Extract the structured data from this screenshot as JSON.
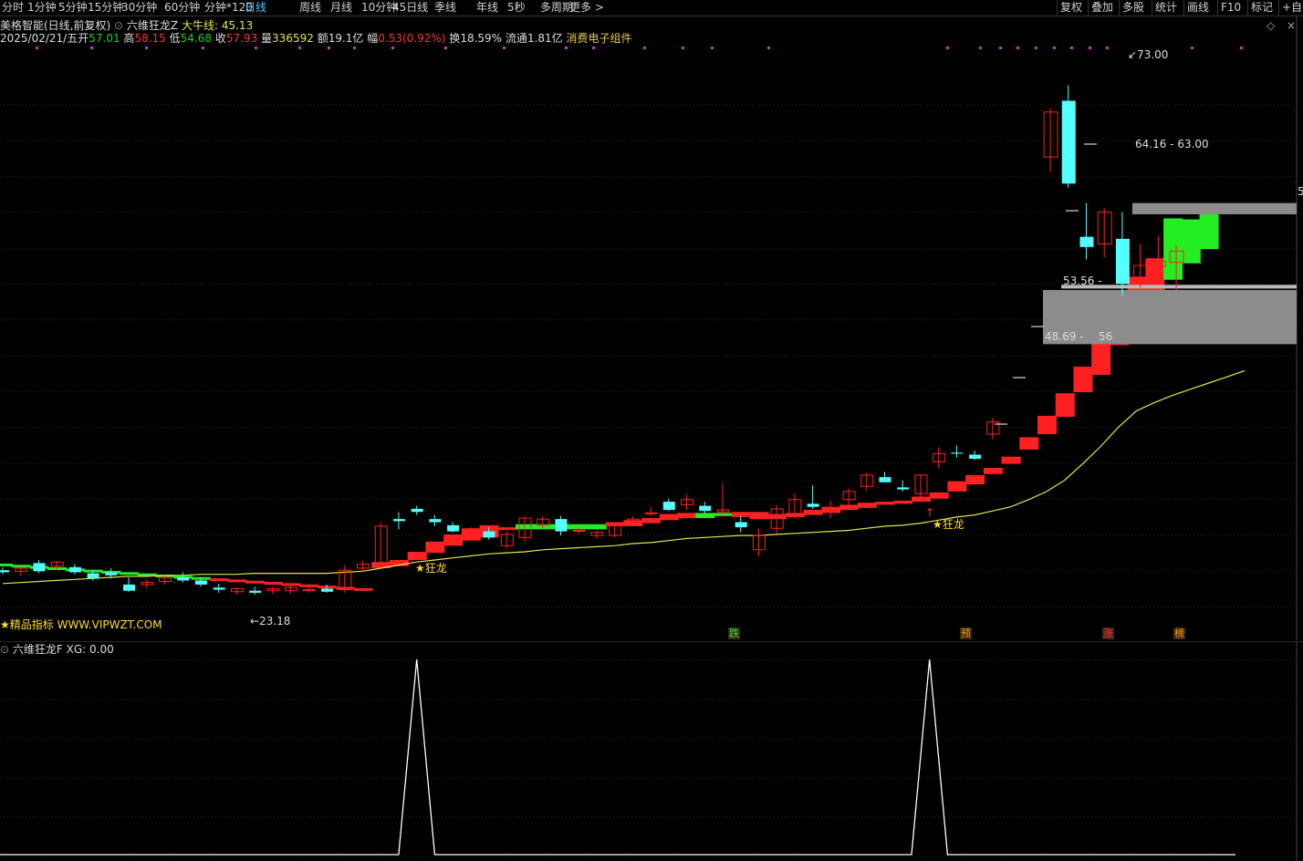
{
  "toolbar": {
    "periods": [
      "分时",
      "1分钟",
      "5分钟",
      "15分钟",
      "30分钟",
      "60分钟",
      "分钟*120",
      "日线",
      "周线",
      "月线",
      "10分钟",
      "45日线",
      "季线",
      "年线",
      "5秒",
      "多周期",
      "更多 >"
    ],
    "active_period": "日线",
    "right_buttons": [
      "复权",
      "叠加",
      "多股",
      "统计",
      "画线",
      "F10",
      "标记",
      "+自选"
    ]
  },
  "header": {
    "stock_title": "美格智能(日线,前复权)",
    "indicator_name": "六维狂龙Z",
    "ma_label": "大牛线:",
    "ma_value": "45.13",
    "diamond_icon": "◇",
    "close_icon": "×"
  },
  "quote": {
    "date": "2025/02/21/五",
    "open_label": "开",
    "open": "57.01",
    "high_label": "高",
    "high": "58.15",
    "low_label": "低",
    "low": "54.68",
    "close_label": "收",
    "close": "57.93",
    "vol_label": "量",
    "vol": "336592",
    "amount_label": "额",
    "amount": "19.1亿",
    "change_label": "幅",
    "change": "0.53(0.92%)",
    "turnover_label": "换",
    "turnover": "18.59%",
    "float_label": "流通",
    "float": "1.81亿",
    "concept": "消费电子组件"
  },
  "annotations": {
    "max_price": "73.00",
    "min_price": "23.18",
    "zone_upper": "64.16 - 63.00",
    "zone_mid": "53.56 -",
    "zone_lower": "48.69 -",
    "zone_lower_tail": "56",
    "dragon_label": "狂龙",
    "watermark": "★精品指标 WWW.VIPWZT.COM",
    "right_edge_mark": "5"
  },
  "chips": [
    {
      "text": "跌",
      "color": "#33dd33"
    },
    {
      "text": "预",
      "color": "#ff9900"
    },
    {
      "text": "涨",
      "color": "#ff3333"
    },
    {
      "text": "榜",
      "color": "#ff9900"
    }
  ],
  "sub_indicator": {
    "name": "六维狂龙F",
    "value_text": "XG: 0.00"
  },
  "colors": {
    "up": "#ff2020",
    "down": "#54ffff",
    "green_band": "#22ee22",
    "ma": "#e6e24a",
    "zone": "#8c8c8c",
    "grid": "#2a2a2a",
    "dots": "#cc33cc",
    "signal": "#ffffff"
  },
  "chart_data": [
    {
      "type": "candlestick",
      "title": "美格智能(日线,前复权)",
      "ylim": [
        20,
        76
      ],
      "series": [
        {
          "name": "K线",
          "ohlc": [
            [
              25.6,
              25.9,
              25.2,
              25.4
            ],
            [
              25.5,
              25.9,
              25.1,
              25.8
            ],
            [
              26.3,
              26.6,
              25.3,
              25.5
            ],
            [
              26.0,
              26.5,
              25.6,
              26.4
            ],
            [
              25.9,
              26.2,
              25.2,
              25.4
            ],
            [
              25.3,
              25.6,
              24.6,
              24.8
            ],
            [
              25.4,
              25.8,
              24.8,
              25.1
            ],
            [
              24.2,
              24.9,
              23.5,
              23.6
            ],
            [
              24.2,
              24.7,
              23.8,
              24.4
            ],
            [
              24.5,
              25.1,
              24.2,
              24.9
            ],
            [
              24.9,
              25.4,
              24.4,
              24.6
            ],
            [
              24.6,
              24.9,
              24.0,
              24.2
            ],
            [
              23.9,
              24.3,
              23.4,
              23.7
            ],
            [
              23.5,
              23.9,
              23.2,
              23.8
            ],
            [
              23.6,
              24.0,
              23.2,
              23.4
            ],
            [
              23.6,
              24.0,
              23.3,
              23.8
            ],
            [
              23.6,
              24.1,
              23.3,
              23.9
            ],
            [
              23.6,
              24.0,
              23.4,
              23.7
            ],
            [
              23.8,
              24.2,
              23.4,
              23.5
            ],
            [
              23.7,
              26.1,
              23.4,
              25.6
            ],
            [
              25.8,
              26.5,
              25.4,
              26.2
            ],
            [
              26.3,
              30.3,
              26.0,
              29.9
            ],
            [
              30.6,
              31.3,
              29.6,
              30.4
            ],
            [
              31.6,
              31.9,
              31.0,
              31.3
            ],
            [
              30.6,
              31.0,
              29.9,
              30.3
            ],
            [
              30.0,
              30.3,
              29.3,
              29.4
            ],
            [
              29.2,
              29.8,
              28.8,
              29.5
            ],
            [
              29.4,
              29.8,
              28.6,
              28.8
            ],
            [
              28.0,
              29.4,
              27.7,
              29.1
            ],
            [
              28.8,
              30.8,
              28.4,
              30.7
            ],
            [
              30.0,
              30.9,
              29.7,
              30.6
            ],
            [
              30.6,
              30.9,
              29.0,
              29.4
            ],
            [
              29.5,
              29.8,
              29.1,
              29.5
            ],
            [
              29.0,
              29.5,
              28.7,
              29.3
            ],
            [
              29.0,
              30.3,
              28.8,
              30.0
            ],
            [
              30.2,
              30.9,
              29.9,
              30.6
            ],
            [
              31.2,
              31.8,
              30.9,
              31.2
            ],
            [
              32.3,
              32.6,
              31.4,
              31.5
            ],
            [
              32.0,
              33.0,
              31.5,
              32.5
            ],
            [
              31.9,
              32.3,
              31.1,
              31.4
            ],
            [
              31.3,
              34.1,
              30.8,
              31.5
            ],
            [
              30.3,
              30.9,
              29.3,
              29.8
            ],
            [
              27.6,
              29.7,
              27.0,
              29.0
            ],
            [
              29.7,
              32.0,
              29.2,
              31.6
            ],
            [
              31.0,
              33.1,
              30.7,
              32.5
            ],
            [
              32.1,
              33.9,
              31.6,
              31.8
            ],
            [
              31.3,
              32.4,
              30.7,
              31.6
            ],
            [
              32.5,
              33.6,
              31.9,
              33.3
            ],
            [
              33.8,
              35.1,
              33.4,
              34.9
            ],
            [
              34.7,
              35.2,
              34.3,
              34.2
            ],
            [
              33.7,
              34.4,
              33.3,
              33.5
            ],
            [
              33.1,
              35.0,
              32.7,
              34.9
            ],
            [
              36.2,
              37.6,
              35.6,
              37.0
            ],
            [
              37.1,
              37.8,
              36.6,
              37.0
            ],
            [
              36.9,
              37.3,
              36.4,
              36.5
            ],
            [
              38.9,
              40.5,
              38.4,
              40.1
            ]
          ]
        },
        {
          "name": "大牛线",
          "values": [
            24.3,
            24.4,
            24.5,
            24.6,
            24.7,
            24.8,
            24.9,
            25.0,
            25.0,
            25.1,
            25.1,
            25.2,
            25.2,
            25.2,
            25.3,
            25.3,
            25.3,
            25.3,
            25.3,
            25.4,
            25.5,
            25.8,
            26.1,
            26.4,
            26.6,
            26.8,
            27.0,
            27.2,
            27.3,
            27.4,
            27.6,
            27.7,
            27.8,
            27.9,
            28.0,
            28.2,
            28.3,
            28.5,
            28.7,
            28.8,
            28.9,
            29.0,
            29.0,
            29.1,
            29.2,
            29.3,
            29.4,
            29.5,
            29.7,
            29.9,
            30.0,
            30.2,
            30.5,
            30.8,
            31.0,
            31.4,
            31.8,
            32.5,
            33.3,
            34.4,
            36.0,
            37.7,
            39.6,
            41.2,
            42.0,
            42.7,
            43.3,
            43.9,
            44.5,
            45.1
          ]
        }
      ],
      "dragon_blocks": {
        "ranges": [
          [
            25.8,
            26.4
          ],
          [
            26.0,
            26.6
          ],
          [
            26.6,
            27.4
          ],
          [
            27.3,
            28.4
          ],
          [
            28.0,
            29.1
          ],
          [
            28.5,
            29.7
          ],
          [
            28.8,
            30.0
          ],
          [
            29.6,
            29.8
          ],
          [
            29.6,
            30.1
          ],
          [
            29.6,
            30.1
          ],
          [
            29.6,
            30.1
          ],
          [
            29.6,
            30.1
          ],
          [
            29.6,
            30.1
          ],
          [
            29.9,
            30.3
          ],
          [
            29.9,
            30.5
          ],
          [
            30.2,
            30.7
          ],
          [
            30.5,
            31.1
          ],
          [
            30.7,
            31.2
          ],
          [
            30.7,
            31.2
          ],
          [
            30.9,
            31.2
          ],
          [
            30.8,
            31.3
          ],
          [
            30.6,
            31.3
          ],
          [
            30.6,
            31.1
          ],
          [
            30.8,
            31.2
          ],
          [
            31.0,
            31.5
          ],
          [
            31.2,
            31.8
          ],
          [
            31.5,
            32.0
          ],
          [
            31.7,
            32.2
          ],
          [
            32.0,
            32.3
          ],
          [
            32.1,
            32.4
          ],
          [
            32.3,
            32.8
          ],
          [
            32.6,
            33.2
          ],
          [
            33.3,
            34.3
          ],
          [
            34.0,
            34.9
          ],
          [
            35.0,
            35.6
          ],
          [
            36.0,
            36.7
          ],
          [
            37.4,
            38.6
          ],
          [
            38.9,
            40.7
          ],
          [
            40.6,
            42.9
          ],
          [
            43.0,
            45.5
          ],
          [
            44.7,
            48.0
          ],
          [
            47.6,
            51.3
          ],
          [
            49.9,
            54.3
          ],
          [
            50.9,
            56.1
          ],
          [
            54.0,
            60.0
          ],
          [
            55.6,
            59.9
          ],
          [
            57.0,
            60.5
          ]
        ],
        "green_from": 44
      },
      "ylabel": ""
    },
    {
      "type": "line",
      "title": "六维狂龙F",
      "series": [
        {
          "name": "XG",
          "values": [
            0,
            0,
            0,
            0,
            0,
            0,
            0,
            0,
            0,
            0,
            0,
            0,
            0,
            0,
            0,
            0,
            0,
            0,
            0,
            0,
            0,
            0,
            0,
            1,
            0,
            0,
            0,
            0,
            0,
            0,
            0,
            0,
            0,
            0,
            0,
            0,
            0,
            0,
            0,
            0,
            0,
            0,
            0,
            0,
            0,
            0,
            0,
            0,
            0,
            0,
            0,
            0,
            1,
            0,
            0,
            0,
            0,
            0,
            0,
            0,
            0,
            0,
            0,
            0,
            0,
            0,
            0,
            0,
            0,
            0
          ]
        }
      ],
      "ylim": [
        0,
        1
      ]
    }
  ]
}
